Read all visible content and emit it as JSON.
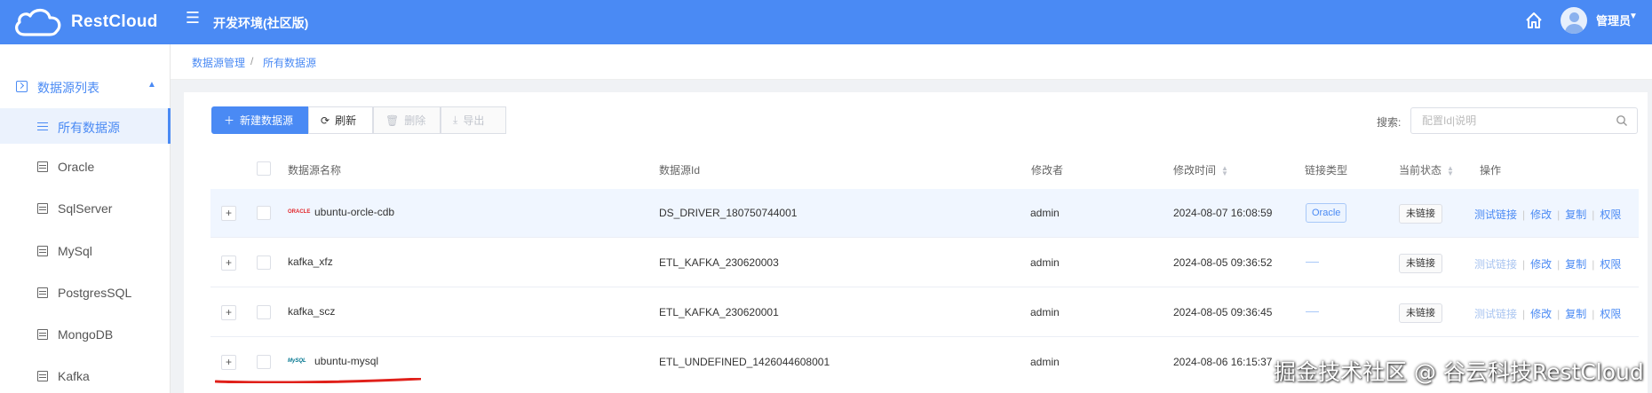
{
  "header": {
    "logo_text": "RestCloud",
    "env_title": "开发环境(社区版)",
    "user_name": "管理员"
  },
  "sidebar": {
    "group_label": "数据源列表",
    "items": [
      {
        "label": "所有数据源",
        "active": true
      },
      {
        "label": "Oracle"
      },
      {
        "label": "SqlServer"
      },
      {
        "label": "MySql"
      },
      {
        "label": "PostgresSQL"
      },
      {
        "label": "MongoDB"
      },
      {
        "label": "Kafka"
      }
    ]
  },
  "breadcrumb": [
    "数据源管理",
    "所有数据源"
  ],
  "toolbar": {
    "new_label": "新建数据源",
    "refresh_label": "刷新",
    "delete_label": "删除",
    "export_label": "导出",
    "search_label": "搜索:",
    "search_placeholder": "配置Id|说明"
  },
  "table": {
    "columns": [
      "数据源名称",
      "数据源Id",
      "修改者",
      "修改时间",
      "链接类型",
      "当前状态",
      "操作"
    ],
    "rows": [
      {
        "name": "ubuntu-orcle-cdb",
        "logo": "ORACLE",
        "id": "DS_DRIVER_180750744001",
        "editor": "admin",
        "time": "2024-08-07 16:08:59",
        "type": "Oracle",
        "status": "未链接",
        "test_enabled": true
      },
      {
        "name": "kafka_xfz",
        "logo": "",
        "id": "ETL_KAFKA_230620003",
        "editor": "admin",
        "time": "2024-08-05 09:36:52",
        "type": "",
        "status": "未链接",
        "test_enabled": false
      },
      {
        "name": "kafka_scz",
        "logo": "",
        "id": "ETL_KAFKA_230620001",
        "editor": "admin",
        "time": "2024-08-05 09:36:45",
        "type": "",
        "status": "未链接",
        "test_enabled": false
      },
      {
        "name": "ubuntu-mysql",
        "logo": "MySQL",
        "id": "ETL_UNDEFINED_1426044608001",
        "editor": "admin",
        "time": "2024-08-06 16:15:37",
        "type": "",
        "status": "",
        "test_enabled": true
      }
    ],
    "actions": [
      "测试链接",
      "修改",
      "复制",
      "权限"
    ]
  },
  "watermark": "掘金技术社区 @ 谷云科技RestCloud",
  "colors": {
    "primary": "#4a8af4",
    "underline": "#e0201a"
  }
}
